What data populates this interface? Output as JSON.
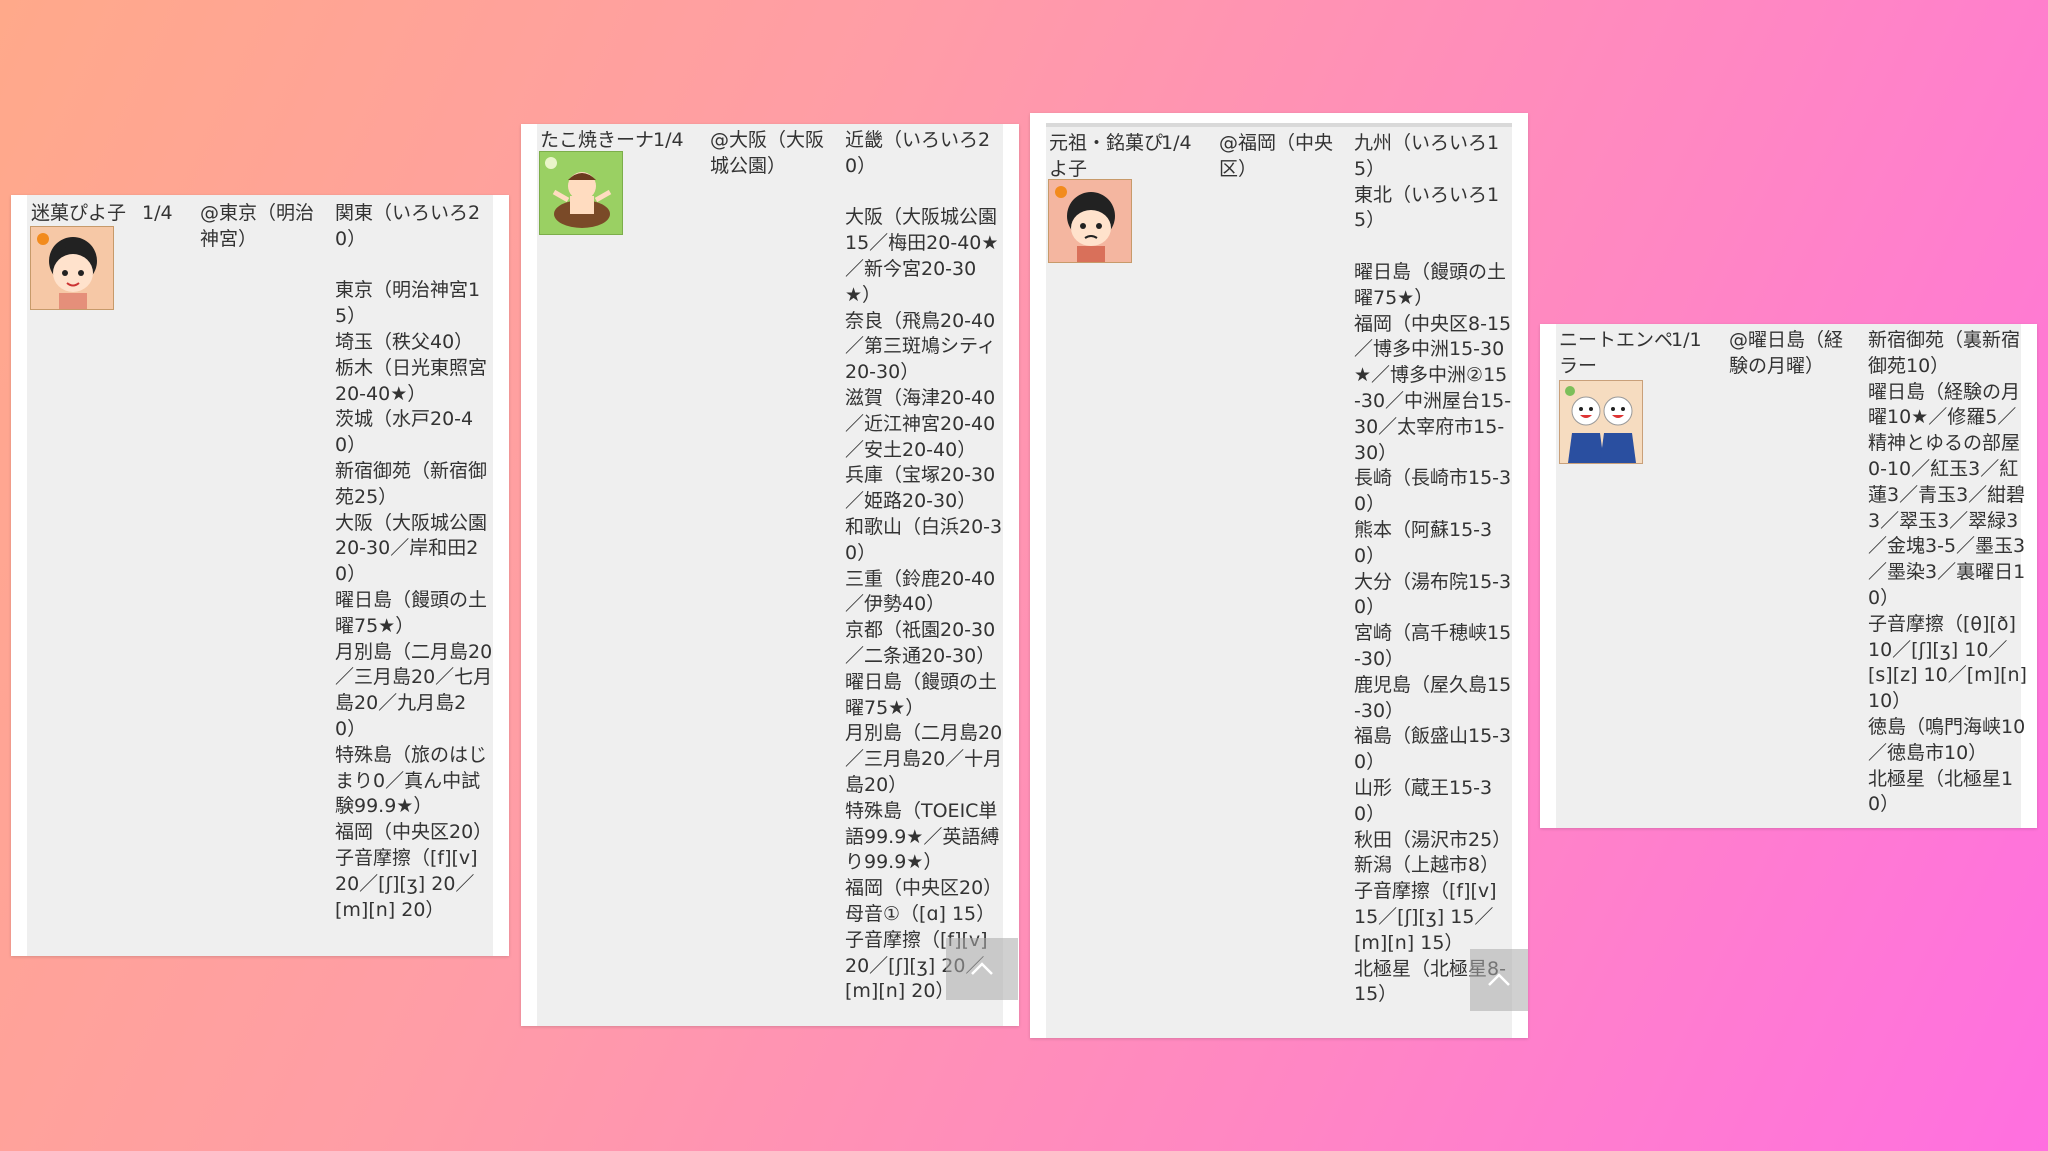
{
  "colors": {
    "bg_start": "#ffa98a",
    "bg_end": "#ff6fe0",
    "card_bg": "#ffffff",
    "row_bg": "#efefef",
    "text": "#333333"
  },
  "cards": [
    {
      "name": "迷菓ぴよ子",
      "count": "1/4",
      "location": "@東京（明治神宮）",
      "areas": "関東（いろいろ20）\n\n東京（明治神宮15）\n埼玉（秩父40）\n栃木（日光東照宮20-40★）\n茨城（水戸20-40）\n新宿御苑（新宿御苑25）\n大阪（大阪城公園20-30／岸和田20）\n曜日島（饅頭の土曜75★）\n月別島（二月島20／三月島20／七月島20／九月島20）\n特殊島（旅のはじまり0／真ん中試験99.9★）\n福岡（中央区20）\n子音摩擦（[f][v] 20／[ʃ][ʒ] 20／[m][n] 20）",
      "avatar_icon": "girl-character-icon"
    },
    {
      "name": "たこ焼きーナ",
      "count": "1/4",
      "location": "@大阪（大阪城公園）",
      "areas": "近畿（いろいろ20）\n\n大阪（大阪城公園15／梅田20-40★／新今宮20-30★）\n奈良（飛鳥20-40／第三斑鳩シティ20-30）\n滋賀（海津20-40／近江神宮20-40／安土20-40）\n兵庫（宝塚20-30／姫路20-30）\n和歌山（白浜20-30）\n三重（鈴鹿20-40／伊勢40）\n京都（祇園20-30／二条通20-30）\n曜日島（饅頭の土曜75★）\n月別島（二月島20／三月島20／十月島20）\n特殊島（TOEIC単語99.9★／英語縛り99.9★）\n福岡（中央区20）\n母音①（[ɑ] 15）\n子音摩擦（[f][v] 20／[ʃ][ʒ] 20／[m][n] 20）",
      "avatar_icon": "takoyaki-character-icon"
    },
    {
      "name": "元祖・銘菓ぴよ子",
      "count": "1/4",
      "location": "@福岡（中央区）",
      "areas": "九州（いろいろ15）\n東北（いろいろ15）\n\n曜日島（饅頭の土曜75★）\n福岡（中央区8-15／博多中洲15-30★／博多中洲②15-30／中洲屋台15-30／太宰府市15-30）\n長崎（長崎市15-30）\n熊本（阿蘇15-30）\n大分（湯布院15-30）\n宮崎（高千穂峡15-30）\n鹿児島（屋久島15-30）\n福島（飯盛山15-30）\n山形（蔵王15-30）\n秋田（湯沢市25）\n新潟（上越市8）\n子音摩擦（[f][v] 15／[ʃ][ʒ] 15／[m][n] 15）\n北極星（北極星8-15）",
      "avatar_icon": "boy-character-icon"
    },
    {
      "name": "ニートエンペラー",
      "count": "1/1",
      "location": "@曜日島（経験の月曜）",
      "areas": "新宿御苑（裏新宿御苑10）\n曜日島（経験の月曜10★／修羅5／精神とゆるの部屋0-10／紅玉3／紅蓮3／青玉3／紺碧3／翠玉3／翠緑3／金塊3-5／墨玉3／墨染3／裏曜日10）\n子音摩擦（[θ][ð] 10／[ʃ][ʒ] 10／[s][z] 10／[m][n] 10）\n徳島（鳴門海峡10／徳島市10）\n北極星（北極星10）",
      "avatar_icon": "twin-emperor-icon"
    }
  ]
}
